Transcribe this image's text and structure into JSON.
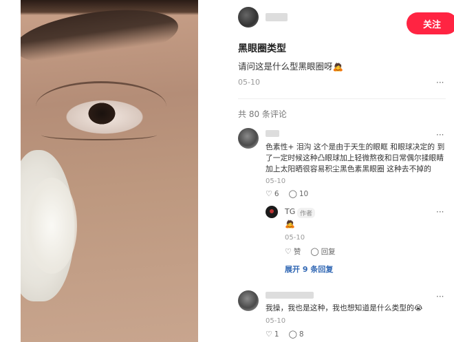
{
  "post": {
    "follow_label": "关注",
    "title": "黑眼圈类型",
    "description": "请问这是什么型黑眼圈呀🙇",
    "date": "05-10",
    "more": "···"
  },
  "comments_count": "共 80 条评论",
  "comments": [
    {
      "text_line1": "色素性+ 泪沟 这个是由于天生的眼眶 和眼球决定的 到",
      "text_line2": "了一定时候这种凸眼球加上轻微熬夜和日常偶尔揉眼睛",
      "text_line3": "加上太阳晒很容易积尘黑色素黑眼圈 这种去不掉的",
      "date": "05-10",
      "likes": "6",
      "replies": "10",
      "more": "···"
    },
    {
      "text": "我操，我也是这种，我也想知道是什么类型的😭",
      "date": "05-10",
      "likes": "1",
      "replies": "8",
      "more": "···"
    }
  ],
  "reply": {
    "name": "TG",
    "badge": "作者",
    "emoji": "🙇",
    "date": "05-10",
    "like_label": "赞",
    "reply_label": "回复",
    "more": "···"
  },
  "expand_label": "展开 9 条回复"
}
